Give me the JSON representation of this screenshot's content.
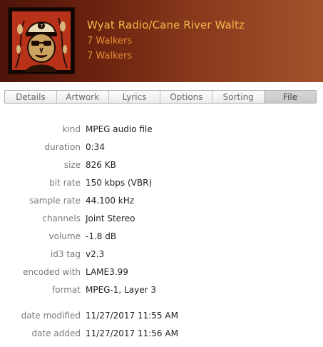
{
  "header": {
    "title": "Wyat Radio/Cane River Waltz",
    "artist": "7 Walkers",
    "album": "7 Walkers"
  },
  "colors": {
    "header_gradient_start": "#4e1409",
    "header_gradient_end": "#a2532c",
    "title_color": "#f2b84a",
    "subtitle_color": "#e5902e",
    "label_color": "#7a7a7a",
    "value_color": "#222222"
  },
  "tabs": [
    {
      "label": "Details",
      "active": false
    },
    {
      "label": "Artwork",
      "active": false
    },
    {
      "label": "Lyrics",
      "active": false
    },
    {
      "label": "Options",
      "active": false
    },
    {
      "label": "Sorting",
      "active": false
    },
    {
      "label": "File",
      "active": true
    }
  ],
  "file_info": [
    {
      "label": "kind",
      "value": "MPEG audio file"
    },
    {
      "label": "duration",
      "value": "0:34"
    },
    {
      "label": "size",
      "value": "826 KB"
    },
    {
      "label": "bit rate",
      "value": "150 kbps (VBR)"
    },
    {
      "label": "sample rate",
      "value": "44.100 kHz"
    },
    {
      "label": "channels",
      "value": "Joint Stereo"
    },
    {
      "label": "volume",
      "value": "-1.8 dB"
    },
    {
      "label": "id3 tag",
      "value": "v2.3"
    },
    {
      "label": "encoded with",
      "value": "LAME3.99"
    },
    {
      "label": "format",
      "value": "MPEG-1, Layer 3"
    }
  ],
  "dates": [
    {
      "label": "date modified",
      "value": "11/27/2017 11:55 AM"
    },
    {
      "label": "date added",
      "value": "11/27/2017 11:56 AM"
    }
  ]
}
